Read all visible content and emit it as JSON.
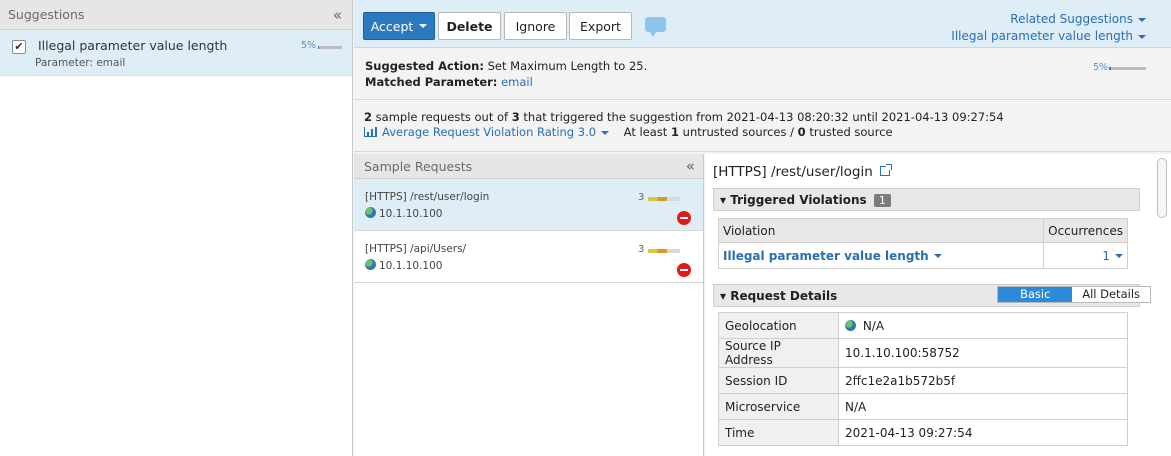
{
  "left_panel": {
    "header": "Suggestions",
    "collapse_glyph": "«",
    "item": {
      "title": "Illegal parameter value length",
      "subtitle": "Parameter: email",
      "percent": "5%",
      "progress_fraction": 0.05
    }
  },
  "toolbar": {
    "accept_label": "Accept",
    "delete_label": "Delete",
    "ignore_label": "Ignore",
    "export_label": "Export",
    "related_suggestions": "Related Suggestions",
    "related_violation": "Illegal parameter value length"
  },
  "action": {
    "label": "Suggested Action:",
    "value": "Set Maximum Length to 25.",
    "matched_label": "Matched Parameter:",
    "matched_value": "email",
    "percent": "5%",
    "progress_fraction": 0.05
  },
  "stats": {
    "count_a": "2",
    "text_a": "sample requests out of",
    "count_b": "3",
    "text_b": "that triggered the suggestion from 2021-04-13 08:20:32 until 2021-04-13 09:27:54",
    "rating_link": "Average Request Violation Rating 3.0",
    "untrusted_prefix": "At least",
    "untrusted_count": "1",
    "untrusted_text": "untrusted sources /",
    "trusted_count": "0",
    "trusted_text": "trusted source"
  },
  "samples": {
    "header": "Sample Requests",
    "collapse_glyph": "«",
    "items": [
      {
        "path": "[HTTPS] /rest/user/login",
        "ip": "10.1.10.100",
        "rating": "3"
      },
      {
        "path": "[HTTPS] /api/Users/",
        "ip": "10.1.10.100",
        "rating": "3"
      }
    ]
  },
  "details": {
    "title": "[HTTPS] /rest/user/login",
    "triggered_header": "Triggered Violations",
    "triggered_count": "1",
    "violation_col": "Violation",
    "occurrences_col": "Occurrences",
    "violation_name": "Illegal parameter value length",
    "violation_occurrences": "1",
    "request_header": "Request Details",
    "basic_label": "Basic",
    "all_label": "All Details",
    "rows": [
      {
        "key": "Geolocation",
        "value": "N/A"
      },
      {
        "key": "Source IP Address",
        "value": "10.1.10.100:58752"
      },
      {
        "key": "Session ID",
        "value": "2ffc1e2a1b572b5f"
      },
      {
        "key": "Microservice",
        "value": "N/A"
      },
      {
        "key": "Time",
        "value": "2021-04-13 09:27:54"
      }
    ]
  }
}
